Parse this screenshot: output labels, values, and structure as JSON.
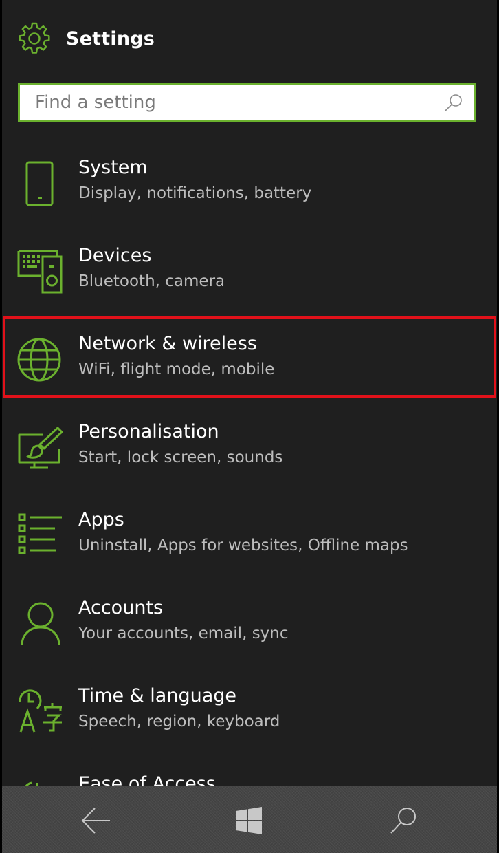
{
  "header": {
    "title": "Settings",
    "icon": "gear-icon"
  },
  "search": {
    "placeholder": "Find a setting",
    "value": "",
    "icon": "search-icon"
  },
  "accent_color": "#6bb12e",
  "highlight_color": "#e1111a",
  "items": [
    {
      "name": "System",
      "desc": "Display, notifications, battery",
      "icon": "phone-icon"
    },
    {
      "name": "Devices",
      "desc": "Bluetooth, camera",
      "icon": "devices-icon"
    },
    {
      "name": "Network & wireless",
      "desc": "WiFi, flight mode, mobile",
      "icon": "globe-icon",
      "highlighted": true
    },
    {
      "name": "Personalisation",
      "desc": "Start, lock screen, sounds",
      "icon": "paint-brush-icon"
    },
    {
      "name": "Apps",
      "desc": "Uninstall, Apps for websites, Offline maps",
      "icon": "apps-list-icon"
    },
    {
      "name": "Accounts",
      "desc": "Your accounts, email, sync",
      "icon": "person-icon"
    },
    {
      "name": "Time & language",
      "desc": "Speech, region, keyboard",
      "icon": "time-language-icon"
    },
    {
      "name": "Ease of Access",
      "desc": "",
      "icon": "ease-of-access-icon"
    }
  ],
  "navbar": {
    "back": "back-arrow-icon",
    "start": "windows-logo-icon",
    "search": "search-icon"
  }
}
